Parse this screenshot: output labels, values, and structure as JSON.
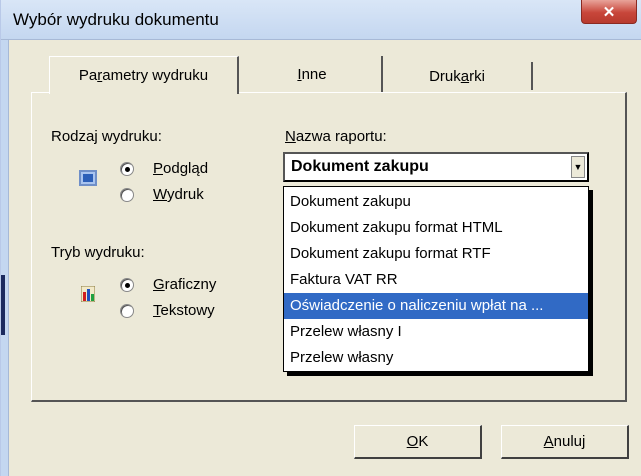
{
  "window": {
    "title": "Wybór wydruku dokumentu",
    "close_glyph": "✕"
  },
  "tabs": [
    {
      "label_pre": "Pa",
      "label_u": "r",
      "label_post": "ametry wydruku",
      "active": true
    },
    {
      "label_pre": "",
      "label_u": "I",
      "label_post": "nne",
      "active": false
    },
    {
      "label_pre": "Druk",
      "label_u": "a",
      "label_post": "rki",
      "active": false
    }
  ],
  "rodzaj": {
    "label": "Rodzaj wydruku:",
    "options": [
      {
        "pre": "",
        "u": "P",
        "post": "odgląd",
        "checked": true
      },
      {
        "pre": "",
        "u": "W",
        "post": "ydruk",
        "checked": false
      }
    ]
  },
  "tryb": {
    "label": "Tryb wydruku:",
    "options": [
      {
        "pre": "",
        "u": "G",
        "post": "raficzny",
        "checked": true
      },
      {
        "pre": "",
        "u": "T",
        "post": "ekstowy",
        "checked": false
      }
    ]
  },
  "report": {
    "label_pre": "",
    "label_u": "N",
    "label_post": "azwa raportu:",
    "selected": "Dokument zakupu",
    "items": [
      "Dokument zakupu",
      "Dokument zakupu format HTML",
      "Dokument zakupu format RTF",
      "Faktura VAT RR",
      "Oświadczenie o naliczeniu wpłat na ...",
      "Przelew własny I",
      "Przelew własny"
    ],
    "highlighted_index": 4
  },
  "buttons": {
    "ok": {
      "pre": "",
      "u": "O",
      "post": "K"
    },
    "cancel": {
      "pre": "",
      "u": "A",
      "post": "nuluj"
    }
  }
}
